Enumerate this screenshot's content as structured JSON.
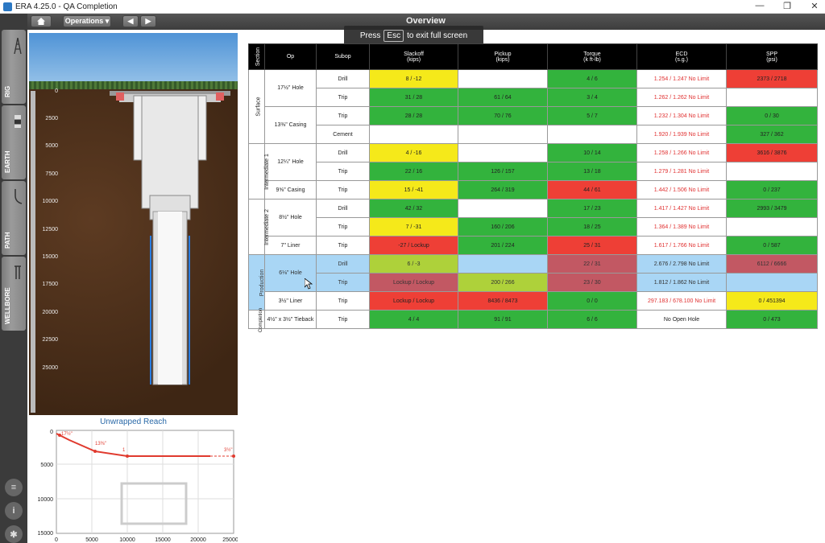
{
  "window": {
    "title": "ERA 4.25.0 - QA Completion",
    "controls": [
      "—",
      "❐",
      "✕"
    ]
  },
  "toolbar": {
    "home_icon": "home-icon",
    "dropdown_label": "Operations ▾",
    "prev": "◀",
    "next": "▶",
    "title": "Overview"
  },
  "toast": {
    "press": "Press",
    "key": "Esc",
    "suffix": "to exit full screen"
  },
  "rail": {
    "tabs": [
      "RIG",
      "EARTH",
      "PATH",
      "WELLBORE"
    ],
    "bottom_icons": [
      "layers-icon",
      "info-icon",
      "gear-icon"
    ]
  },
  "well": {
    "depth_ticks": [
      "0",
      "2500",
      "5000",
      "7500",
      "10000",
      "12500",
      "15000",
      "17500",
      "20000",
      "22500",
      "25000"
    ]
  },
  "reach": {
    "title": "Unwrapped Reach",
    "x_ticks": [
      "0",
      "5000",
      "10000",
      "15000",
      "20000",
      "25000"
    ],
    "y_ticks": [
      "0",
      "5000",
      "10000",
      "15000"
    ],
    "labels": [
      "17½\"",
      "13⅜\"",
      "1",
      "3½\""
    ]
  },
  "table": {
    "headers": {
      "section": "Section",
      "op": "Op",
      "subop": "Subop",
      "slackoff": "Slackoff\n(kips)",
      "pickup": "Pickup\n(kips)",
      "torque": "Torque\n(k ft-lb)",
      "ecd": "ECD\n(s.g.)",
      "spp": "SPP\n(psi)"
    },
    "rows": [
      {
        "section": "Surface",
        "op": "17½\" Hole",
        "sub": "Drill",
        "slackoff": "8 / -12",
        "pickup": "",
        "torque": "4 / 6",
        "ecd": "1.254 / 1.247 No Limit",
        "spp": "2373 / 2718"
      },
      {
        "section": "",
        "op": "",
        "sub": "Trip",
        "slackoff": "31 / 28",
        "pickup": "61 / 64",
        "torque": "3 / 4",
        "ecd": "1.262 / 1.262 No Limit",
        "spp": ""
      },
      {
        "section": "",
        "op": "13⅜\" Casing",
        "sub": "Trip",
        "slackoff": "28 / 28",
        "pickup": "70 / 76",
        "torque": "5 / 7",
        "ecd": "1.232 / 1.304 No Limit",
        "spp": "0 / 30"
      },
      {
        "section": "",
        "op": "",
        "sub": "Cement",
        "slackoff": "",
        "pickup": "",
        "torque": "",
        "ecd": "1.920 / 1.939 No Limit",
        "spp": "327 / 362"
      },
      {
        "section": "Intermediate 1",
        "op": "12¼\" Hole",
        "sub": "Drill",
        "slackoff": "4 / -16",
        "pickup": "",
        "torque": "10 / 14",
        "ecd": "1.258 / 1.266 No Limit",
        "spp": "3616 / 3876"
      },
      {
        "section": "",
        "op": "",
        "sub": "Trip",
        "slackoff": "22 / 16",
        "pickup": "126 / 157",
        "torque": "13 / 18",
        "ecd": "1.279 / 1.281 No Limit",
        "spp": ""
      },
      {
        "section": "",
        "op": "9⅝\" Casing",
        "sub": "Trip",
        "slackoff": "15 / -41",
        "pickup": "264 / 319",
        "torque": "44 / 61",
        "ecd": "1.442 / 1.506 No Limit",
        "spp": "0 / 237"
      },
      {
        "section": "Intermediate 2",
        "op": "8½\" Hole",
        "sub": "Drill",
        "slackoff": "42 / 32",
        "pickup": "",
        "torque": "17 / 23",
        "ecd": "1.417 / 1.427 No Limit",
        "spp": "2993 / 3479"
      },
      {
        "section": "",
        "op": "",
        "sub": "Trip",
        "slackoff": "7 / -31",
        "pickup": "160 / 206",
        "torque": "18 / 25",
        "ecd": "1.364 / 1.389 No Limit",
        "spp": ""
      },
      {
        "section": "",
        "op": "7\" Liner",
        "sub": "Trip",
        "slackoff": "-27 / Lockup",
        "pickup": "201 / 224",
        "torque": "25 / 31",
        "ecd": "1.617 / 1.766 No Limit",
        "spp": "0 / 587"
      },
      {
        "section": "Production",
        "op": "6⅛\" Hole",
        "sub": "Drill",
        "slackoff": "6 / -3",
        "pickup": "",
        "torque": "22 / 31",
        "ecd": "2.676 / 2.798 No Limit",
        "spp": "6112 / 6666"
      },
      {
        "section": "",
        "op": "",
        "sub": "Trip",
        "slackoff": "Lockup / Lockup",
        "pickup": "200 / 266",
        "torque": "23 / 30",
        "ecd": "1.812 / 1.862 No Limit",
        "spp": ""
      },
      {
        "section": "",
        "op": "3½\" Liner",
        "sub": "Trip",
        "slackoff": "Lockup / Lockup",
        "pickup": "8436 / 8473",
        "torque": "0 / 0",
        "ecd": "297.183 / 678.100 No Limit",
        "spp": "0 / 451394"
      },
      {
        "section": "Completion",
        "op": "4½\" x 3½\" Tieback",
        "sub": "Trip",
        "slackoff": "4 / 4",
        "pickup": "91 / 91",
        "torque": "6 / 6",
        "ecd": "No Open Hole",
        "spp": "0 / 473"
      }
    ]
  },
  "colors": {
    "green": "#33b33d",
    "yellow": "#f5e91a",
    "red": "#ee3f36",
    "lime": "#aed13a",
    "rose": "#c25863",
    "blue": "#a9d6f5"
  }
}
